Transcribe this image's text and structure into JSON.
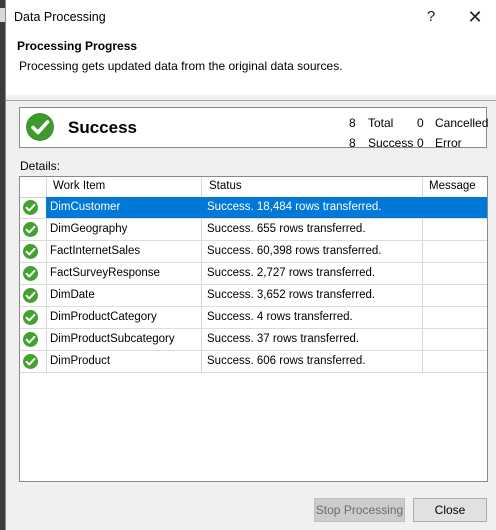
{
  "window": {
    "title": "Data Processing",
    "help_icon": "?",
    "close_icon": "✕"
  },
  "header": {
    "title": "Processing Progress",
    "subtitle": "Processing gets updated data from the original data sources."
  },
  "summary": {
    "status": "Success",
    "total_count": "8",
    "total_label": "Total",
    "success_count": "8",
    "success_label": "Success",
    "cancelled_count": "0",
    "cancelled_label": "Cancelled",
    "error_count": "0",
    "error_label": "Error"
  },
  "details_label": "Details:",
  "grid": {
    "columns": [
      "Work Item",
      "Status",
      "Message"
    ],
    "rows": [
      {
        "item": "DimCustomer",
        "status": "Success. 18,484 rows transferred.",
        "message": ""
      },
      {
        "item": "DimGeography",
        "status": "Success. 655 rows transferred.",
        "message": ""
      },
      {
        "item": "FactInternetSales",
        "status": "Success. 60,398 rows transferred.",
        "message": ""
      },
      {
        "item": "FactSurveyResponse",
        "status": "Success. 2,727 rows transferred.",
        "message": ""
      },
      {
        "item": "DimDate",
        "status": "Success. 3,652 rows transferred.",
        "message": ""
      },
      {
        "item": "DimProductCategory",
        "status": "Success. 4 rows transferred.",
        "message": ""
      },
      {
        "item": "DimProductSubcategory",
        "status": "Success. 37 rows transferred.",
        "message": ""
      },
      {
        "item": "DimProduct",
        "status": "Success. 606 rows transferred.",
        "message": ""
      }
    ]
  },
  "buttons": {
    "stop": "Stop Processing",
    "close": "Close"
  },
  "colors": {
    "success_green": "#3f9a2d",
    "selection_blue": "#0078d7"
  }
}
